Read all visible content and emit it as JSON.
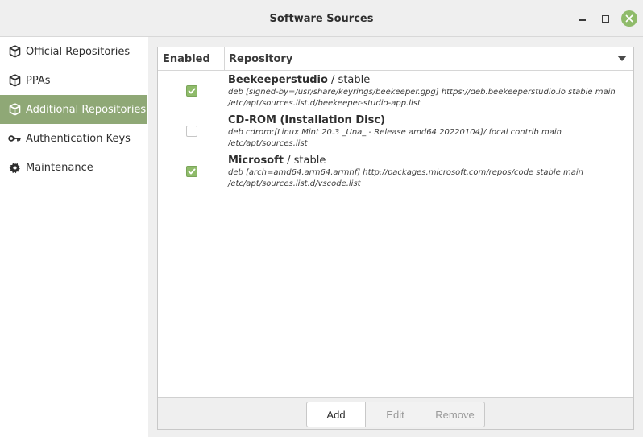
{
  "window": {
    "title": "Software Sources"
  },
  "sidebar": {
    "items": [
      {
        "label": "Official Repositories",
        "icon": "package-icon",
        "active": false
      },
      {
        "label": "PPAs",
        "icon": "package-icon",
        "active": false
      },
      {
        "label": "Additional Repositories",
        "icon": "package-icon",
        "active": true
      },
      {
        "label": "Authentication Keys",
        "icon": "key-icon",
        "active": false
      },
      {
        "label": "Maintenance",
        "icon": "gear-icon",
        "active": false
      }
    ]
  },
  "table": {
    "columns": {
      "enabled": "Enabled",
      "repository": "Repository"
    },
    "rows": [
      {
        "enabled": true,
        "name": "Beekeeperstudio",
        "suffix": " / stable",
        "line": "deb [signed-by=/usr/share/keyrings/beekeeper.gpg] https://deb.beekeeperstudio.io stable main",
        "file": "/etc/apt/sources.list.d/beekeeper-studio-app.list"
      },
      {
        "enabled": false,
        "name": "CD-ROM (Installation Disc)",
        "suffix": "",
        "line": "deb cdrom:[Linux Mint 20.3 _Una_ - Release amd64 20220104]/ focal contrib main",
        "file": "/etc/apt/sources.list"
      },
      {
        "enabled": true,
        "name": "Microsoft",
        "suffix": " / stable",
        "line": "deb [arch=amd64,arm64,armhf] http://packages.microsoft.com/repos/code stable main",
        "file": "/etc/apt/sources.list.d/vscode.list"
      }
    ]
  },
  "toolbar": {
    "add_label": "Add",
    "edit_label": "Edit",
    "remove_label": "Remove"
  },
  "colors": {
    "accent": "#8fbb6a",
    "sidebar_active": "#8fa876"
  }
}
